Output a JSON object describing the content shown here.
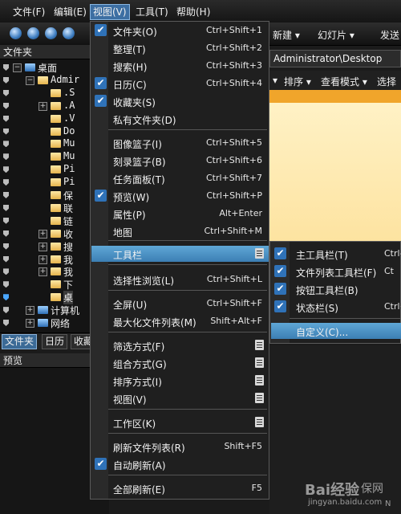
{
  "menubar": {
    "items": [
      "文件(F)",
      "编辑(E)",
      "视图(V)",
      "工具(T)",
      "帮助(H)"
    ]
  },
  "toolbar": {
    "items": [
      "新建 ▾",
      "幻灯片 ▾",
      "发送"
    ]
  },
  "left_panel": {
    "header": "文件夹",
    "tree": [
      {
        "label": "桌面"
      },
      {
        "label": "Admir"
      },
      {
        "label": ".S"
      },
      {
        "label": ".A"
      },
      {
        "label": ".V"
      },
      {
        "label": "Do"
      },
      {
        "label": "Mu"
      },
      {
        "label": "Mu"
      },
      {
        "label": "Pi"
      },
      {
        "label": "Pi"
      },
      {
        "label": "保"
      },
      {
        "label": "联"
      },
      {
        "label": "链"
      },
      {
        "label": "收"
      },
      {
        "label": "搜"
      },
      {
        "label": "我"
      },
      {
        "label": "我"
      },
      {
        "label": "下"
      },
      {
        "label": "桌"
      },
      {
        "label": "计算机"
      },
      {
        "label": "网络"
      }
    ],
    "tabs": [
      "文件夹",
      "日历",
      "收藏"
    ],
    "preview_header": "预览"
  },
  "address": {
    "path": "Administrator\\Desktop"
  },
  "right_toolbar": {
    "items": [
      "▾",
      "排序 ▾",
      "查看模式 ▾",
      "选择"
    ]
  },
  "view_menu": {
    "items": [
      {
        "label": "文件夹(O)",
        "shortcut": "Ctrl+Shift+1",
        "checked": true
      },
      {
        "label": "整理(T)",
        "shortcut": "Ctrl+Shift+2",
        "checked": false
      },
      {
        "label": "搜索(H)",
        "shortcut": "Ctrl+Shift+3",
        "checked": false
      },
      {
        "label": "日历(C)",
        "shortcut": "Ctrl+Shift+4",
        "checked": true
      },
      {
        "label": "收藏夹(S)",
        "shortcut": "",
        "checked": true
      },
      {
        "label": "私有文件夹(D)",
        "shortcut": "",
        "checked": false
      },
      {
        "label": "图像篮子(I)",
        "shortcut": "Ctrl+Shift+5",
        "checked": false
      },
      {
        "label": "刻录篮子(B)",
        "shortcut": "Ctrl+Shift+6",
        "checked": false
      },
      {
        "label": "任务面板(T)",
        "shortcut": "Ctrl+Shift+7",
        "checked": false
      },
      {
        "label": "预览(W)",
        "shortcut": "Ctrl+Shift+P",
        "checked": true
      },
      {
        "label": "属性(P)",
        "shortcut": "Alt+Enter",
        "checked": false
      },
      {
        "label": "地图",
        "shortcut": "Ctrl+Shift+M",
        "checked": false
      },
      {
        "label": "工具栏"
      },
      {
        "label": "选择性浏览(L)",
        "shortcut": "Ctrl+Shift+L"
      },
      {
        "label": "全屏(U)",
        "shortcut": "Ctrl+Shift+F"
      },
      {
        "label": "最大化文件列表(M)",
        "shortcut": "Shift+Alt+F"
      },
      {
        "label": "筛选方式(F)"
      },
      {
        "label": "组合方式(G)"
      },
      {
        "label": "排序方式(I)"
      },
      {
        "label": "视图(V)"
      },
      {
        "label": "工作区(K)"
      },
      {
        "label": "刷新文件列表(R)",
        "shortcut": "Shift+F5"
      },
      {
        "label": "自动刷新(A)",
        "checked": true
      },
      {
        "label": "全部刷新(E)",
        "shortcut": "F5"
      }
    ]
  },
  "toolbar_submenu": {
    "items": [
      {
        "label": "主工具栏(T)",
        "shortcut": "Ctrl-",
        "checked": true
      },
      {
        "label": "文件列表工具栏(F)",
        "shortcut": "Ct",
        "checked": true
      },
      {
        "label": "按钮工具栏(B)",
        "checked": true
      },
      {
        "label": "状态栏(S)",
        "shortcut": "Ctrl+",
        "checked": true
      },
      {
        "label": "自定义(C)..."
      }
    ]
  },
  "watermark": {
    "brand": "Bai经验",
    "url": "jingyan.baidu.com",
    "corner": "保网",
    "corner2": "N"
  },
  "colors": {
    "highlight": "#4a90c4",
    "check": "#2f72b8",
    "menu_bg": "#1f1f1f",
    "content": "#fde3a0"
  }
}
